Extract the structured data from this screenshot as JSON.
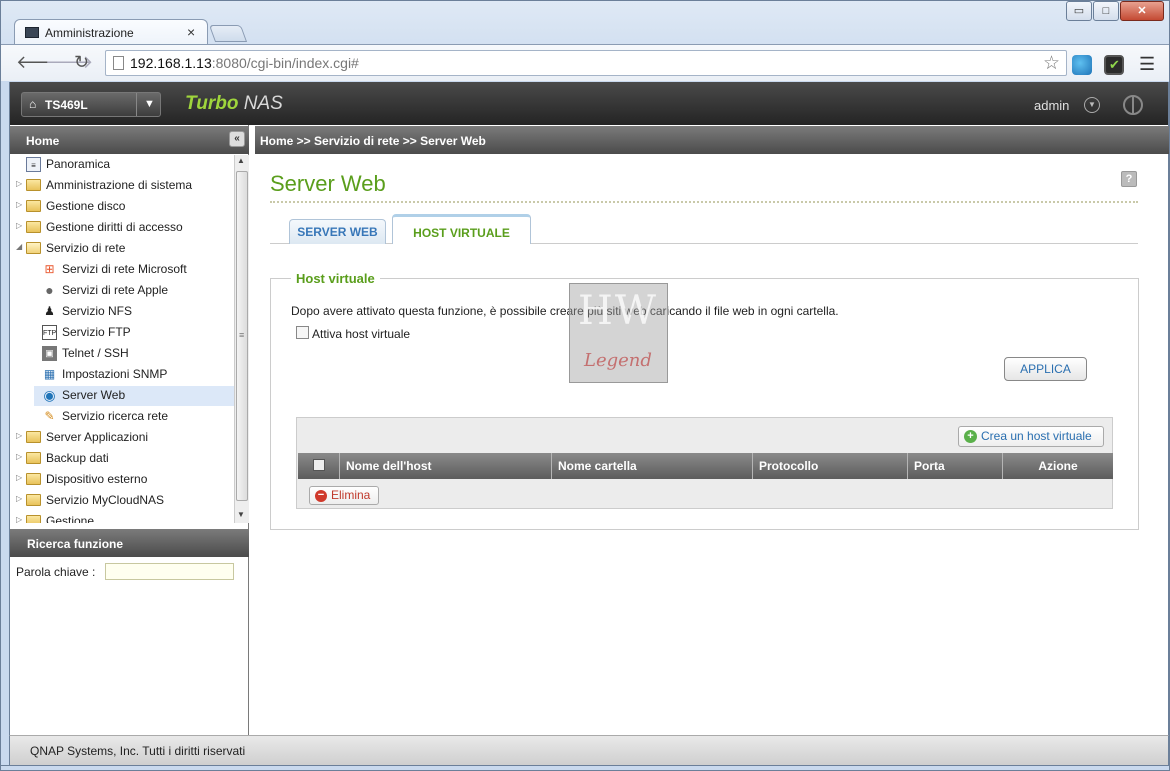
{
  "browser": {
    "tab_title": "Amministrazione",
    "tab_close": "×",
    "url_host": "192.168.1.13",
    "url_rest": ":8080/cgi-bin/index.cgi#",
    "window_buttons": {
      "minimize": "▭",
      "maximize": "□",
      "close": "✕"
    }
  },
  "header": {
    "device_name": "TS469L",
    "brand_turbo": "Turbo",
    "brand_nas": " NAS",
    "user": "admin"
  },
  "sidebar": {
    "home_label": "Home",
    "collapse_glyph": "«",
    "tree": [
      {
        "label": "Panoramica",
        "icon": "overview-icon"
      },
      {
        "label": "Amministrazione di sistema",
        "icon": "folder-icon"
      },
      {
        "label": "Gestione disco",
        "icon": "folder-icon"
      },
      {
        "label": "Gestione diritti di accesso",
        "icon": "folder-icon"
      },
      {
        "label": "Servizio di rete",
        "icon": "folder-open-icon"
      },
      {
        "label": "Servizi di rete Microsoft",
        "icon": "windows-icon"
      },
      {
        "label": "Servizi di rete Apple",
        "icon": "apple-icon"
      },
      {
        "label": "Servizio NFS",
        "icon": "linux-icon"
      },
      {
        "label": "Servizio FTP",
        "icon": "ftp-icon"
      },
      {
        "label": "Telnet / SSH",
        "icon": "terminal-icon"
      },
      {
        "label": "Impostazioni SNMP",
        "icon": "snmp-icon"
      },
      {
        "label": "Server Web",
        "icon": "globe-icon"
      },
      {
        "label": "Servizio ricerca rete",
        "icon": "search-network-icon"
      },
      {
        "label": "Server Applicazioni",
        "icon": "folder-icon"
      },
      {
        "label": "Backup dati",
        "icon": "folder-icon"
      },
      {
        "label": "Dispositivo esterno",
        "icon": "folder-icon"
      },
      {
        "label": "Servizio MyCloudNAS",
        "icon": "folder-icon"
      },
      {
        "label": "Gestione",
        "icon": "folder-icon"
      }
    ],
    "search_title": "Ricerca funzione",
    "keyword_label": "Parola chiave :"
  },
  "main": {
    "breadcrumb": "Home >> Servizio di rete >> Server Web",
    "title": "Server Web",
    "help_glyph": "?",
    "tabs": [
      {
        "label": "SERVER WEB",
        "active": false
      },
      {
        "label": "HOST VIRTUALE",
        "active": true
      }
    ],
    "section_title": "Host virtuale",
    "description": "Dopo avere attivato questa funzione, è possibile creare più siti web caricando il file web in ogni cartella.",
    "enable_label": "Attiva host virtuale",
    "enable_checked": false,
    "apply_label": "APPLICA",
    "create_label": "Crea un host virtuale",
    "columns": [
      "Nome dell'host",
      "Nome cartella",
      "Protocollo",
      "Porta",
      "Azione"
    ],
    "rows": [],
    "delete_label": "Elimina"
  },
  "watermark": {
    "top": "HW",
    "bottom": "Legend"
  },
  "footer": "QNAP Systems, Inc. Tutti i diritti riservati",
  "colors": {
    "accent_green": "#5a9e1c",
    "link_blue": "#2a6fb0",
    "brand_green": "#9fd53c"
  }
}
